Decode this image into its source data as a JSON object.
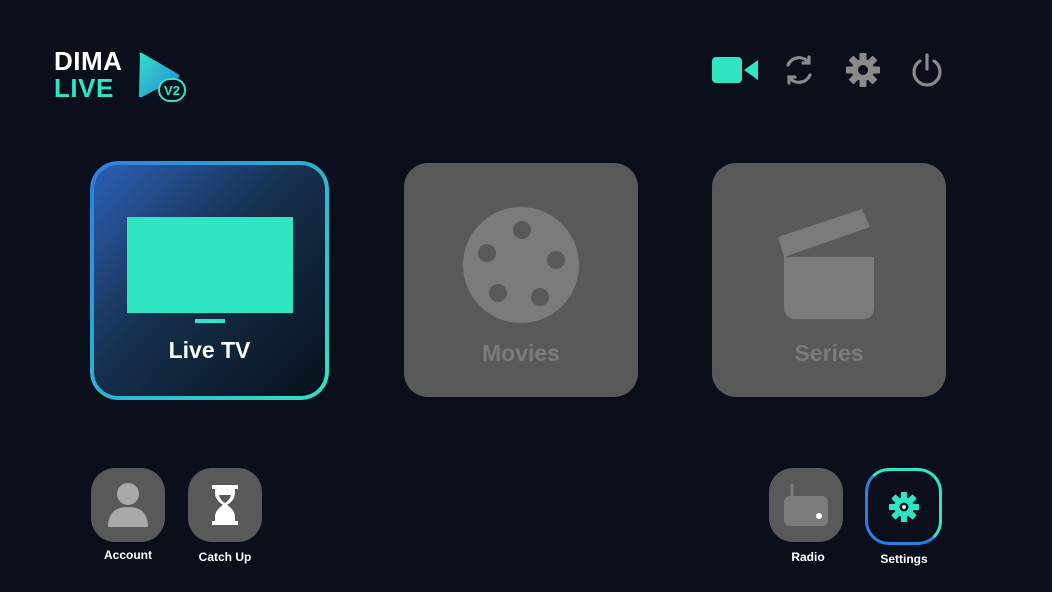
{
  "brand": {
    "line1": "DIMA",
    "line2": "LIVE",
    "version": "V2",
    "accent": "#2ee6c4"
  },
  "toolbar": {
    "items": [
      {
        "name": "camera-icon"
      },
      {
        "name": "refresh-icon"
      },
      {
        "name": "gear-icon"
      },
      {
        "name": "power-icon"
      }
    ]
  },
  "tiles": [
    {
      "label": "Live TV",
      "icon": "tv-icon",
      "state": "focused"
    },
    {
      "label": "Movies",
      "icon": "film-reel-icon",
      "state": "normal"
    },
    {
      "label": "Series",
      "icon": "clapperboard-icon",
      "state": "normal"
    }
  ],
  "bottom": {
    "account": "Account",
    "catchup": "Catch Up",
    "radio": "Radio",
    "settings": "Settings"
  }
}
